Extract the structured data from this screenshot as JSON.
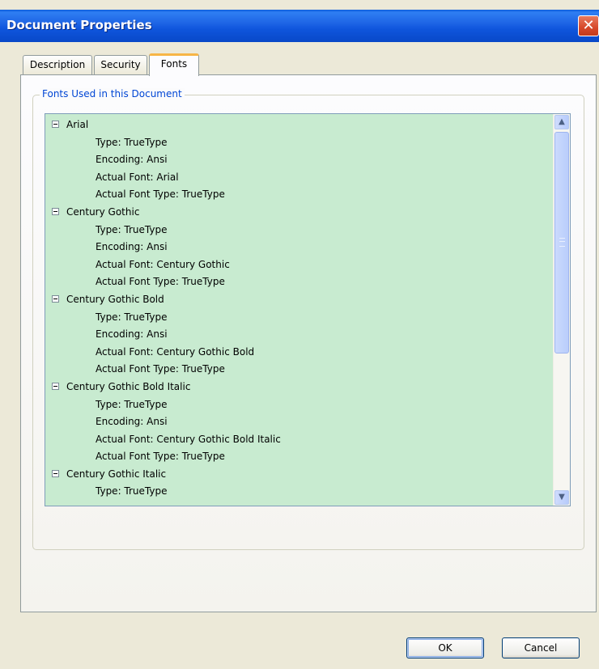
{
  "window": {
    "title": "Document Properties",
    "close_glyph": "✕"
  },
  "tabs": [
    {
      "label": "Description",
      "active": false
    },
    {
      "label": "Security",
      "active": false
    },
    {
      "label": "Fonts",
      "active": true
    }
  ],
  "fonts_panel": {
    "group_label": "Fonts Used in this Document",
    "rows": [
      {
        "kind": "node",
        "text": "Arial"
      },
      {
        "kind": "child",
        "text": "Type: TrueType"
      },
      {
        "kind": "child",
        "text": "Encoding: Ansi"
      },
      {
        "kind": "child",
        "text": "Actual Font: Arial"
      },
      {
        "kind": "child",
        "text": "Actual Font Type: TrueType"
      },
      {
        "kind": "node",
        "text": "Century Gothic"
      },
      {
        "kind": "child",
        "text": "Type: TrueType"
      },
      {
        "kind": "child",
        "text": "Encoding: Ansi"
      },
      {
        "kind": "child",
        "text": "Actual Font: Century Gothic"
      },
      {
        "kind": "child",
        "text": "Actual Font Type: TrueType"
      },
      {
        "kind": "node",
        "text": "Century Gothic Bold"
      },
      {
        "kind": "child",
        "text": "Type: TrueType"
      },
      {
        "kind": "child",
        "text": "Encoding: Ansi"
      },
      {
        "kind": "child",
        "text": "Actual Font: Century Gothic Bold"
      },
      {
        "kind": "child",
        "text": "Actual Font Type: TrueType"
      },
      {
        "kind": "node",
        "text": "Century Gothic Bold Italic"
      },
      {
        "kind": "child",
        "text": "Type: TrueType"
      },
      {
        "kind": "child",
        "text": "Encoding: Ansi"
      },
      {
        "kind": "child",
        "text": "Actual Font: Century Gothic Bold Italic"
      },
      {
        "kind": "child",
        "text": "Actual Font Type: TrueType"
      },
      {
        "kind": "node",
        "text": "Century Gothic Italic"
      },
      {
        "kind": "child",
        "text": "Type: TrueType"
      }
    ],
    "scroll_up_glyph": "▲",
    "scroll_down_glyph": "▼"
  },
  "buttons": {
    "ok_label": "OK",
    "cancel_label": "Cancel"
  },
  "colors": {
    "titlebar": "#0a5bdc",
    "tree_background": "#c8ebd0",
    "group_label": "#0046d5",
    "active_tab_accent": "#f7b546"
  },
  "icons": {
    "close": "close-icon",
    "collapse": "collapse-icon",
    "scroll_up": "scroll-up-icon",
    "scroll_down": "scroll-down-icon"
  }
}
